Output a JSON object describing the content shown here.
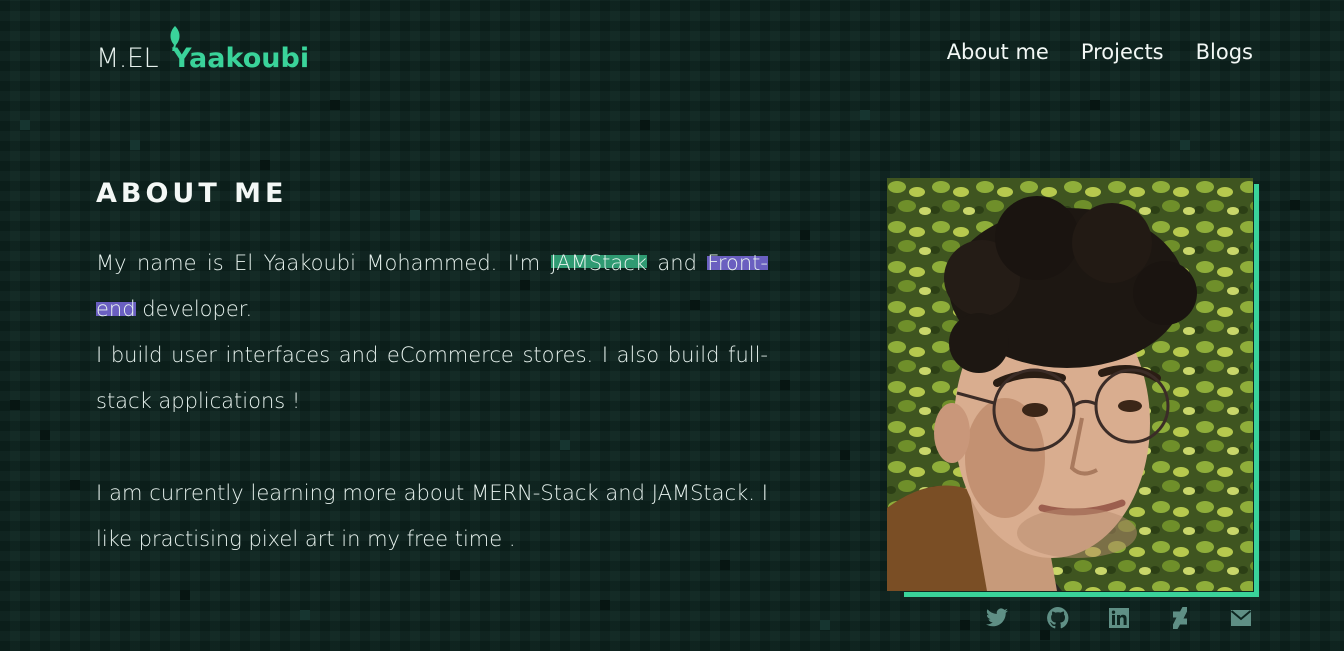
{
  "header": {
    "logo_prefix": "M.EL",
    "logo_name": "Yaakoubi",
    "nav": [
      {
        "label": "About me"
      },
      {
        "label": "Projects"
      },
      {
        "label": "Blogs"
      }
    ]
  },
  "about": {
    "title": "ABOUT ME",
    "p1_before": "My name is El Yaakoubi Mohammed. I'm ",
    "p1_highlight1": "JAMStack",
    "p1_middle": " and ",
    "p1_highlight2": "Front-end",
    "p1_after": " developer.",
    "p2": "I build user interfaces and eCommerce stores. I also build full-stack applications !",
    "p3": "I am currently learning more about MERN-Stack and JAMStack. I like practising pixel art in my free time ."
  },
  "social": {
    "icons": [
      "twitter-icon",
      "github-icon",
      "linkedin-icon",
      "deviantart-icon",
      "mail-icon"
    ]
  },
  "colors": {
    "background": "#0d2520",
    "accent": "#3ad39a",
    "highlight_green": "#2f9a72",
    "highlight_purple": "#6a5fc0",
    "icon": "#5f8f85"
  }
}
